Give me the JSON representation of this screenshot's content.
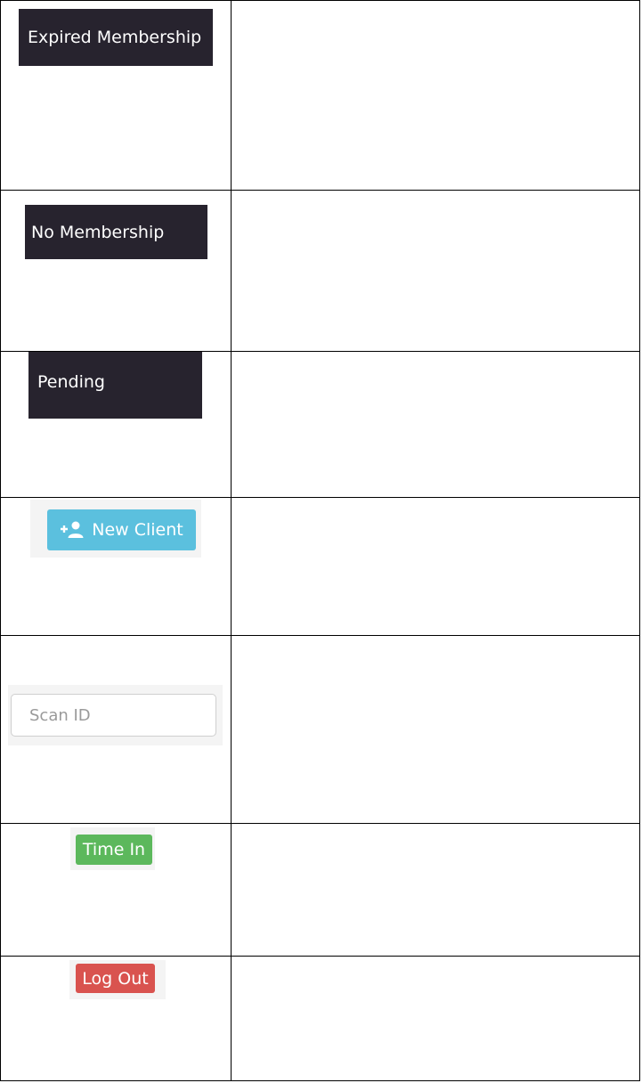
{
  "rows": [
    {
      "ui": "badge",
      "label": "Expired Membership",
      "color": "#27232e",
      "description": ""
    },
    {
      "ui": "badge",
      "label": "No Membership",
      "color": "#27232e",
      "description": ""
    },
    {
      "ui": "badge",
      "label": "Pending",
      "color": "#27232e",
      "description": ""
    },
    {
      "ui": "button",
      "label": "New Client",
      "icon": "add-user-icon",
      "color": "#5bc0de",
      "description": ""
    },
    {
      "ui": "input",
      "placeholder": "Scan ID",
      "value": "",
      "description": ""
    },
    {
      "ui": "button",
      "label": "Time In",
      "color": "#5cb85c",
      "description": ""
    },
    {
      "ui": "button",
      "label": "Log Out",
      "color": "#d9534f",
      "description": ""
    }
  ]
}
